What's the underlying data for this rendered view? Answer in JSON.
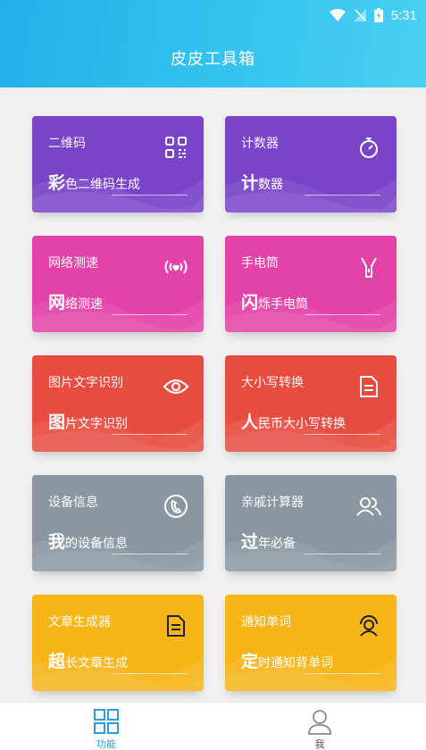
{
  "status_bar": {
    "time": "5:31"
  },
  "header": {
    "title": "皮皮工具箱"
  },
  "cards": [
    {
      "label": "二维码",
      "big": "彩",
      "rest": "色二维码生成",
      "icon": "qrcode-icon",
      "color": "#7a44c8"
    },
    {
      "label": "计数器",
      "big": "计",
      "rest": "数器",
      "icon": "stopwatch-icon",
      "color": "#7a44c8"
    },
    {
      "label": "网络测速",
      "big": "网",
      "rest": "络测速",
      "icon": "signal-heart-icon",
      "color": "#e342a8"
    },
    {
      "label": "手电筒",
      "big": "闪",
      "rest": "烁手电筒",
      "icon": "flashlight-icon",
      "color": "#e342a8"
    },
    {
      "label": "图片文字识别",
      "big": "图",
      "rest": "片文字识别",
      "icon": "eye-icon",
      "color": "#e84c40"
    },
    {
      "label": "大小写转换",
      "big": "人",
      "rest": "民币大小写转换",
      "icon": "document-icon",
      "color": "#e84c40"
    },
    {
      "label": "设备信息",
      "big": "我",
      "rest": "的设备信息",
      "icon": "phone-icon",
      "color": "#8a97a2"
    },
    {
      "label": "亲戚计算器",
      "big": "过",
      "rest": "年必备",
      "icon": "people-icon",
      "color": "#8a97a2"
    },
    {
      "label": "文章生成器",
      "big": "超",
      "rest": "长文章生成",
      "icon": "article-icon",
      "color": "#f7b518"
    },
    {
      "label": "通知单词",
      "big": "定",
      "rest": "时通知背单词",
      "icon": "reminder-icon",
      "color": "#f7b518"
    }
  ],
  "bottom_nav": {
    "items": [
      {
        "label": "功能",
        "icon": "grid-icon",
        "active": true
      },
      {
        "label": "我",
        "icon": "person-icon",
        "active": false
      }
    ]
  }
}
